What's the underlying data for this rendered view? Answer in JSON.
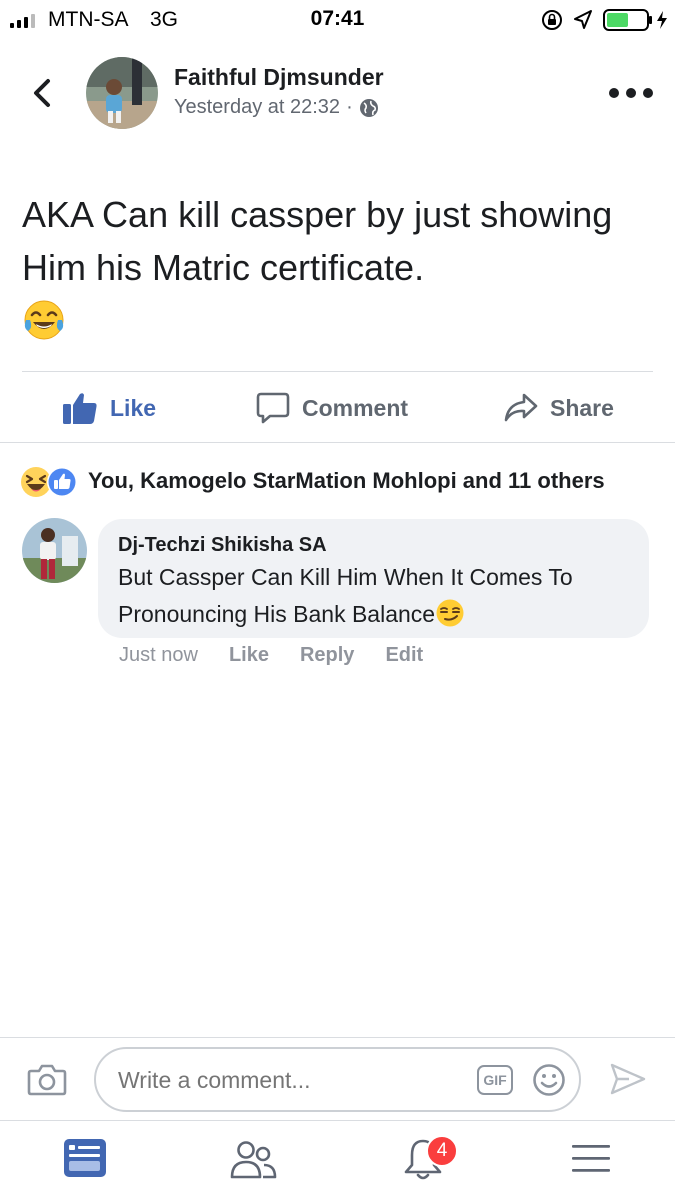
{
  "status_bar": {
    "carrier": "MTN-SA",
    "network": "3G",
    "time": "07:41",
    "battery_level": 0.55,
    "icons": [
      "signal-icon",
      "orientation-lock-icon",
      "location-icon",
      "battery-icon",
      "charging-icon"
    ]
  },
  "post": {
    "author": "Faithful Djmsunder",
    "timestamp": "Yesterday at 22:32",
    "separator": "·",
    "privacy_icon": "globe-icon",
    "text": "AKA Can kill cassper by just showing Him his Matric certificate.",
    "emoji": "face-with-tears-of-joy"
  },
  "actions": {
    "like": "Like",
    "comment": "Comment",
    "share": "Share"
  },
  "reactions": {
    "icons": [
      "haha-reaction-icon",
      "like-reaction-icon"
    ],
    "summary": "You, Kamogelo StarMation Mohlopi and 11 others"
  },
  "comment": {
    "author": "Dj-Techzi Shikisha SA",
    "text": "But Cassper Can Kill Him When It Comes To Pronouncing His Bank Balance",
    "emoji": "smirking-face",
    "time": "Just now",
    "like": "Like",
    "reply": "Reply",
    "edit": "Edit"
  },
  "composer": {
    "placeholder": "Write a comment...",
    "gif_label": "GIF"
  },
  "tab_bar": {
    "items": [
      "news-feed-icon",
      "friends-icon",
      "notifications-icon",
      "menu-icon"
    ],
    "notification_count": "4"
  },
  "colors": {
    "accent": "#4267b2",
    "badge": "#fa3e3e",
    "secondary_text": "#616770",
    "comment_bubble": "#f0f2f5"
  }
}
